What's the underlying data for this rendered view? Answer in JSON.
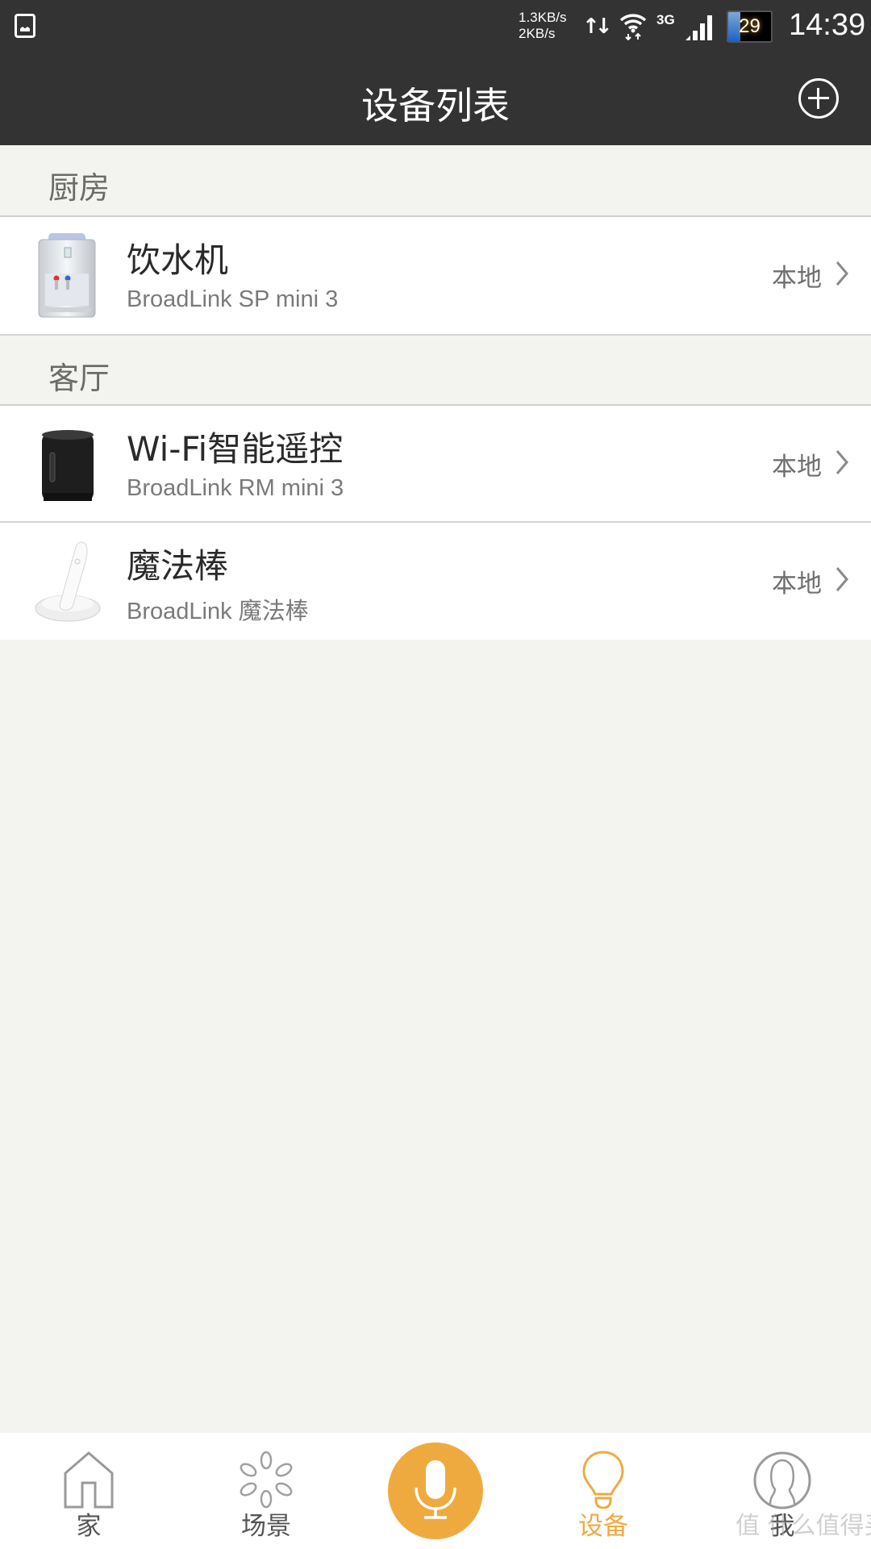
{
  "status_bar": {
    "gallery_icon": "image-notification-icon",
    "speed_up": "1.3KB/s",
    "speed_down": "2KB/s",
    "network_type": "3G",
    "battery_level": "29",
    "time": "14:39"
  },
  "header": {
    "title": "设备列表",
    "add_icon": "plus-circle-icon"
  },
  "sections": [
    {
      "title": "厨房",
      "devices": [
        {
          "name": "饮水机",
          "model": "BroadLink  SP mini 3",
          "status": "本地",
          "icon": "water-dispenser-icon"
        }
      ]
    },
    {
      "title": "客厅",
      "devices": [
        {
          "name": "Wi-Fi智能遥控",
          "model": "BroadLink  RM mini 3",
          "status": "本地",
          "icon": "rm-mini-remote-icon"
        },
        {
          "name": "魔法棒",
          "model": "BroadLink  魔法棒",
          "status": "本地",
          "icon": "magic-wand-icon"
        }
      ]
    }
  ],
  "bottom_nav": {
    "items": [
      {
        "label": "家",
        "icon": "home-icon"
      },
      {
        "label": "场景",
        "icon": "scene-flower-icon"
      },
      {
        "label": "",
        "icon": "microphone-icon"
      },
      {
        "label": "设备",
        "icon": "lightbulb-icon",
        "active": true
      },
      {
        "label": "我",
        "icon": "user-profile-icon"
      }
    ]
  },
  "watermark": "值 什么值得买",
  "colors": {
    "accent": "#efaa3f",
    "header_bg": "#333333",
    "page_bg": "#f3f3ef"
  }
}
